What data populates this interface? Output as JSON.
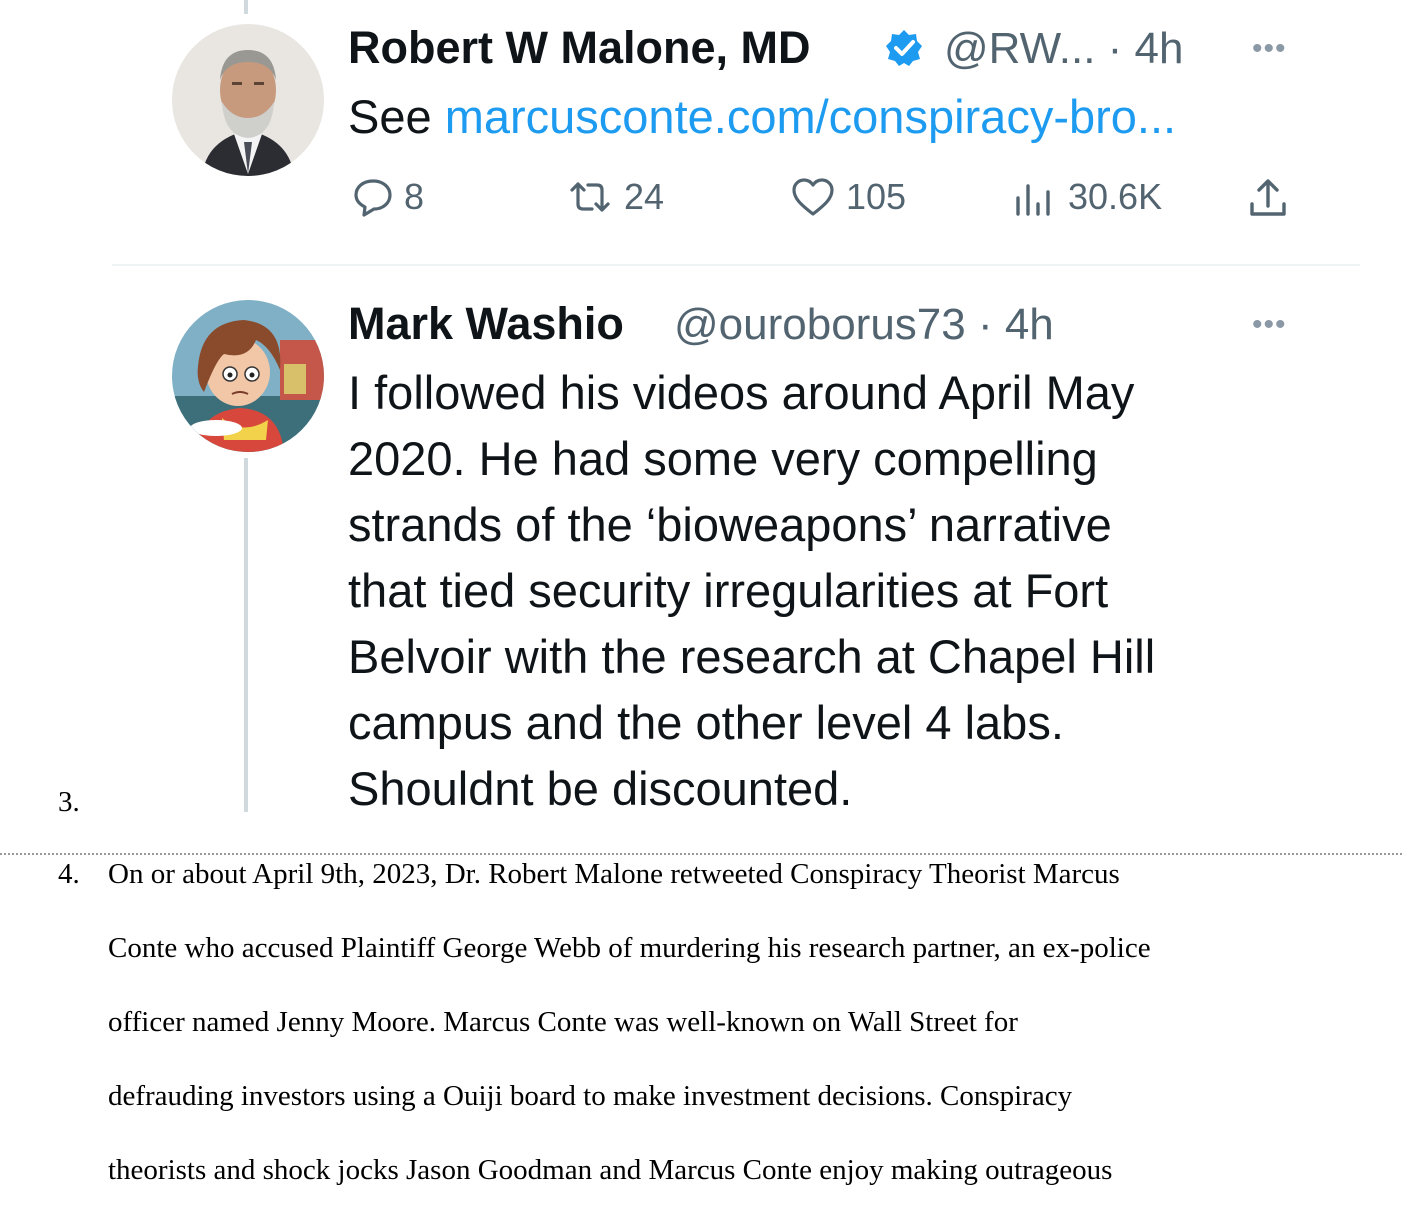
{
  "tweet1": {
    "name": "Robert W Malone, MD",
    "handle_time": "@RW... · 4h",
    "text_prefix": "See",
    "link": "marcusconte.com/conspiracy-bro...",
    "more": "•••",
    "stats": {
      "replies": "8",
      "retweets": "24",
      "likes": "105",
      "views": "30.6K"
    }
  },
  "tweet2": {
    "name": "Mark Washio",
    "handle_time": "@ouroborus73 · 4h",
    "more": "•••",
    "lines": [
      "I followed his videos around April May",
      "2020. He had some very compelling",
      "strands of the ‘bioweapons’ narrative",
      "that tied security irregularities at Fort",
      "Belvoir with the research at Chapel Hill",
      "campus and the other level 4 labs.",
      "Shouldnt be discounted."
    ]
  },
  "doc": {
    "item3_number": "3.",
    "item4_number": "4.",
    "item4_lines": [
      "On or about April 9th, 2023, Dr. Robert Malone retweeted Conspiracy Theorist Marcus",
      "Conte who accused Plaintiff George Webb of murdering his research partner, an ex-police",
      "officer named Jenny Moore.  Marcus Conte was well-known on Wall Street for",
      "defrauding investors using a Ouiji board to make investment decisions.  Conspiracy",
      "theorists and shock jocks Jason Goodman and Marcus Conte enjoy making outrageous"
    ]
  },
  "colors": {
    "link": "#1d9bf0",
    "verified": "#1d9bf0",
    "muted": "#536471",
    "text": "#0f1419"
  }
}
